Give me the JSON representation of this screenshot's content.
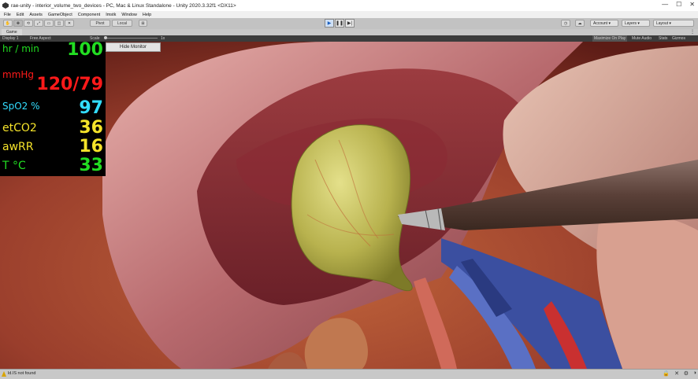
{
  "window": {
    "title": "rae-unity - interior_volume_two_devices - PC, Mac & Linux Standalone - Unity 2020.3.32f1 <DX11>",
    "minimize": "—",
    "maximize": "☐",
    "close": "✕"
  },
  "menu": [
    "File",
    "Edit",
    "Assets",
    "GameObject",
    "Component",
    "Imstk",
    "Window",
    "Help"
  ],
  "toolbar": {
    "pivot": "Pivot",
    "local": "Local",
    "account": "Account",
    "layers": "Layers",
    "layout": "Layout"
  },
  "game_tab": "Game",
  "game_options": {
    "display": "Display 1",
    "aspect": "Free Aspect",
    "scale_label": "Scale",
    "scale_value": "1x",
    "maximize": "Maximize On Play",
    "mute": "Mute Audio",
    "stats": "Stats",
    "gizmos": "Gizmos"
  },
  "monitor": {
    "hide_button": "Hide Monitor",
    "rows": [
      {
        "label": "hr / min",
        "value": "100",
        "color": "#22dd22"
      },
      {
        "label": "mmHg",
        "value": "120/79",
        "color": "#ff1a1a"
      },
      {
        "label": "SpO2 %",
        "value": "97",
        "color": "#33ddff"
      },
      {
        "label": "etCO2",
        "value": "36",
        "color": "#f5e32a"
      },
      {
        "label": "awRR",
        "value": "16",
        "color": "#f5e32a"
      },
      {
        "label": "T   °C",
        "value": "33",
        "color": "#22dd22"
      }
    ]
  },
  "status": {
    "message": "ld.IS not found"
  }
}
